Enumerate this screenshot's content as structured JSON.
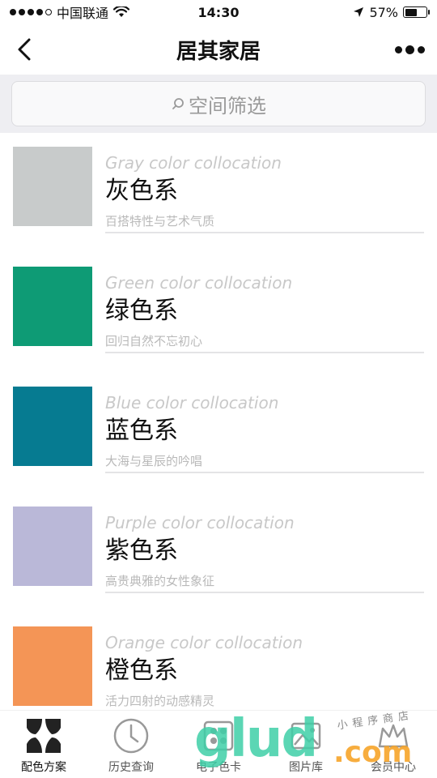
{
  "status_bar": {
    "carrier": "中国联通",
    "time": "14:30",
    "battery": "57%",
    "battery_level": 0.57
  },
  "nav": {
    "title": "居其家居"
  },
  "search": {
    "placeholder": "空间筛选"
  },
  "colors": {
    "gray": "#c8cbcb",
    "green": "#0e9b75",
    "blue": "#067b91",
    "purple": "#bab8d8",
    "orange": "#f49556",
    "active_tab": "#222222",
    "watermark_green": "#3fd0a8",
    "watermark_orange": "#f7a52a"
  },
  "items": [
    {
      "en": "Gray color collocation",
      "cn": "灰色系",
      "sub": "百搭特性与艺术气质",
      "swatch": "#c8cbcb"
    },
    {
      "en": "Green color collocation",
      "cn": "绿色系",
      "sub": "回归自然不忘初心",
      "swatch": "#0e9b75"
    },
    {
      "en": "Blue color collocation",
      "cn": "蓝色系",
      "sub": "大海与星辰的吟唱",
      "swatch": "#067b91"
    },
    {
      "en": "Purple color collocation",
      "cn": "紫色系",
      "sub": "高贵典雅的女性象征",
      "swatch": "#bab8d8"
    },
    {
      "en": "Orange color collocation",
      "cn": "橙色系",
      "sub": "活力四射的动感精灵",
      "swatch": "#f49556"
    }
  ],
  "tabs": [
    {
      "label": "配色方案",
      "icon": "palette-icon",
      "active": true
    },
    {
      "label": "历史查询",
      "icon": "clock-icon",
      "active": false
    },
    {
      "label": "电子色卡",
      "icon": "color-card-icon",
      "active": false
    },
    {
      "label": "图片库",
      "icon": "image-library-icon",
      "active": false
    },
    {
      "label": "会员中心",
      "icon": "member-icon",
      "active": false
    }
  ],
  "watermark": {
    "brand": "glud",
    "domain": ".com",
    "slogan": "小程序商店"
  }
}
